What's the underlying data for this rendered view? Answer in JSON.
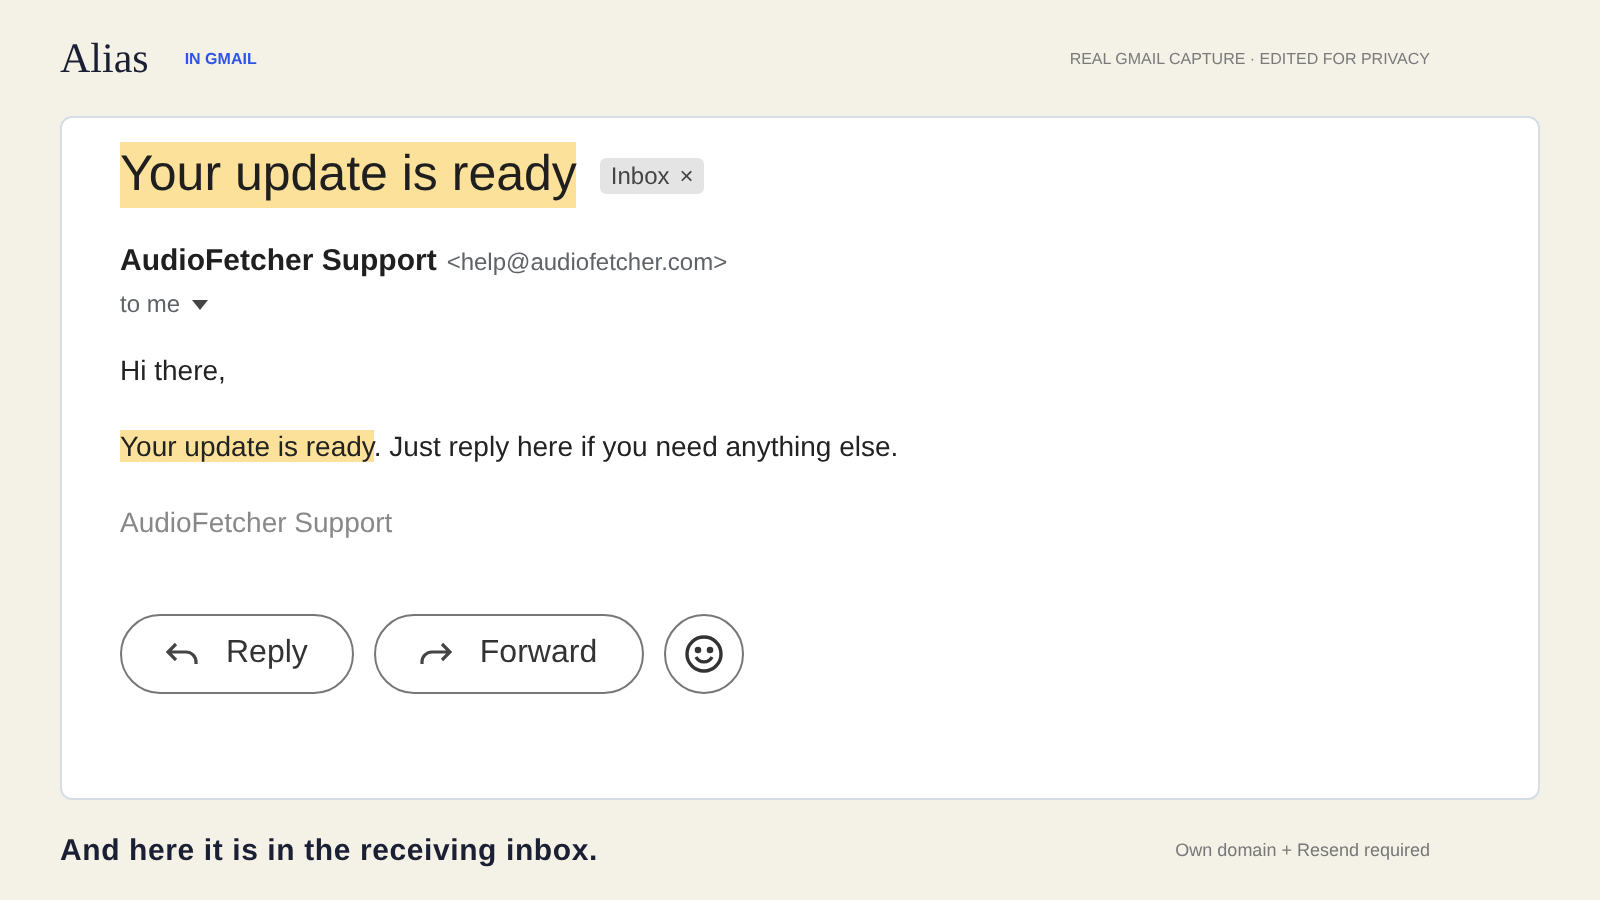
{
  "header": {
    "logo": "Alias",
    "tag": "IN GMAIL",
    "note": "REAL GMAIL CAPTURE · EDITED FOR PRIVACY"
  },
  "email": {
    "subject": "Your update is ready",
    "label": "Inbox",
    "label_close": "×",
    "sender": "AudioFetcher Support",
    "address": "<help@audiofetcher.com>",
    "recipient": "to me",
    "greeting": "Hi there,",
    "body": {
      "highlight": "Your update is ready",
      "rest": ". Just reply here if you need anything else."
    },
    "signature": "AudioFetcher Support",
    "actions": [
      {
        "kind": "reply",
        "label": "Reply"
      },
      {
        "kind": "forward",
        "label": "Forward"
      },
      {
        "kind": "emoji"
      }
    ]
  },
  "footer": {
    "caption": "And here it is in the receiving inbox.",
    "note": "Own domain + Resend required"
  }
}
